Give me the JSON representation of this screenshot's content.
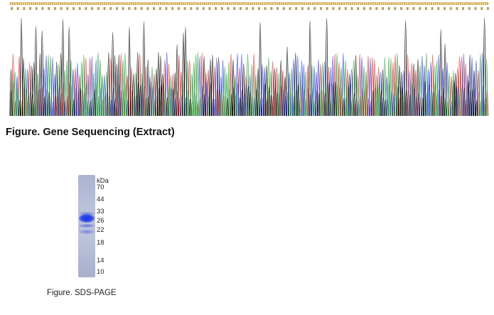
{
  "sequencing": {
    "caption": "Figure. Gene Sequencing (Extract)",
    "trace_colors": {
      "A": "#2e9e3e",
      "C": "#2b3fd9",
      "G": "#111111",
      "T": "#d42a2a"
    },
    "base_letters_color": "#c99a2b",
    "aa_letters_color": "#a08a3a"
  },
  "sds_page": {
    "caption": "Figure. SDS-PAGE",
    "unit_label": "kDa",
    "markers": [
      "70",
      "44",
      "33",
      "26",
      "22",
      "18",
      "14",
      "10"
    ],
    "band_color": "#1e3ee0"
  }
}
